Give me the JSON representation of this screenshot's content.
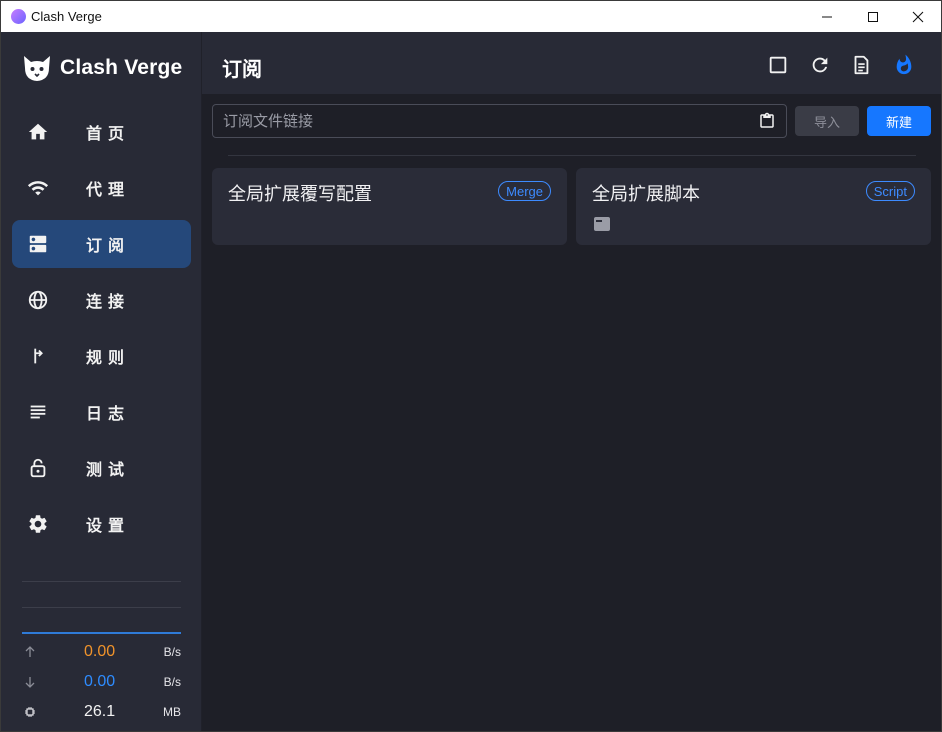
{
  "window": {
    "title": "Clash Verge"
  },
  "logo": {
    "text": "Clash Verge"
  },
  "nav": {
    "items": [
      {
        "label": "首页",
        "icon": "home-icon"
      },
      {
        "label": "代理",
        "icon": "wifi-icon"
      },
      {
        "label": "订阅",
        "icon": "dns-icon",
        "active": true
      },
      {
        "label": "连接",
        "icon": "globe-icon"
      },
      {
        "label": "规则",
        "icon": "fork-icon"
      },
      {
        "label": "日志",
        "icon": "list-icon"
      },
      {
        "label": "测试",
        "icon": "lock-icon"
      },
      {
        "label": "设置",
        "icon": "gear-icon"
      }
    ]
  },
  "traffic": {
    "upload": {
      "value": "0.00",
      "unit": "B/s",
      "color": "#f0932b"
    },
    "download": {
      "value": "0.00",
      "unit": "B/s",
      "color": "#2e8cff"
    },
    "memory": {
      "value": "26.1",
      "unit": "MB"
    }
  },
  "header": {
    "title": "订阅"
  },
  "toolbar": {
    "url_placeholder": "订阅文件链接",
    "url_value": "",
    "import_label": "导入",
    "new_label": "新建"
  },
  "cards": [
    {
      "title": "全局扩展覆写配置",
      "badge": "Merge"
    },
    {
      "title": "全局扩展脚本",
      "badge": "Script"
    }
  ],
  "colors": {
    "accent": "#1677ff",
    "active_nav": "#25487a",
    "sidebar": "#282a36",
    "background": "#1e1f27"
  }
}
